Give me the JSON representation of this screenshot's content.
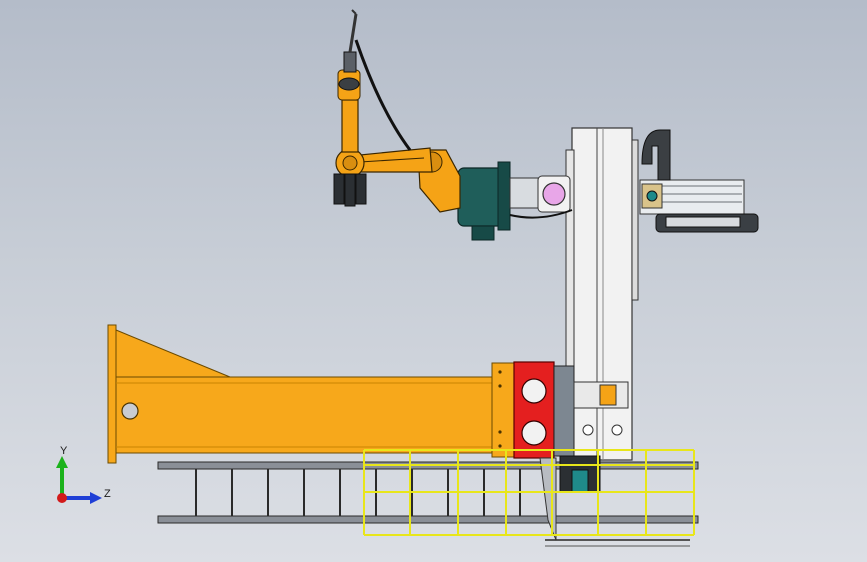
{
  "view": {
    "background_top": "#b4bcc9",
    "background_bottom": "#dcdfe5"
  },
  "triad": {
    "y_label": "Y",
    "z_label": "Z",
    "y_color": "#1bb21b",
    "z_color": "#1f3fd6",
    "x_color": "#d21a1a"
  },
  "colors": {
    "beam_orange": "#f7a81b",
    "robot_orange": "#f5a316",
    "base_teal": "#1f5e5a",
    "carriage_red": "#e41f1f",
    "column_white": "#f2f2f2",
    "ladder_yellow": "#e8e61a",
    "track_grey": "#6f6f6f"
  },
  "icons": {
    "triad": "coordinate-triad-icon",
    "torch": "welding-torch-icon"
  }
}
